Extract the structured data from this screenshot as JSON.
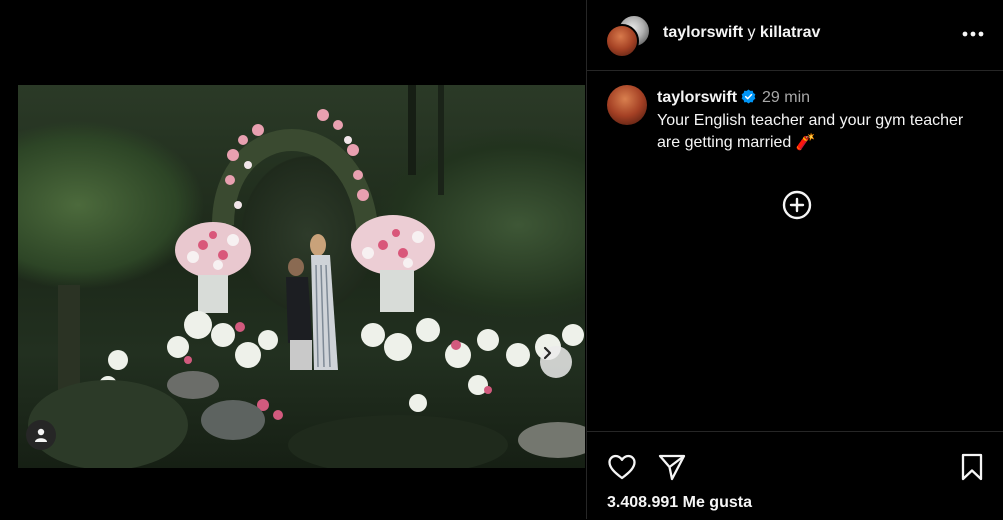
{
  "post": {
    "header_user": "taylorswift",
    "header_conj": "y",
    "header_collab": "killatrav",
    "caption": {
      "username": "taylorswift",
      "time": "29 min",
      "text": "Your English teacher and your gym teacher are getting married",
      "emoji": "🧨"
    },
    "likes": "3.408.991 Me gusta"
  },
  "icons": {
    "more": "more-horizontal-icon",
    "verified": "verified-badge-icon",
    "add": "add-circle-icon",
    "like": "heart-icon",
    "share": "send-icon",
    "save": "bookmark-icon",
    "next": "chevron-right-icon",
    "tags": "user-tag-icon"
  },
  "colors": {
    "background": "#000000",
    "text": "#f5f5f5",
    "muted": "#a8a8a8",
    "verified": "#0095f6",
    "divider": "#262626"
  }
}
